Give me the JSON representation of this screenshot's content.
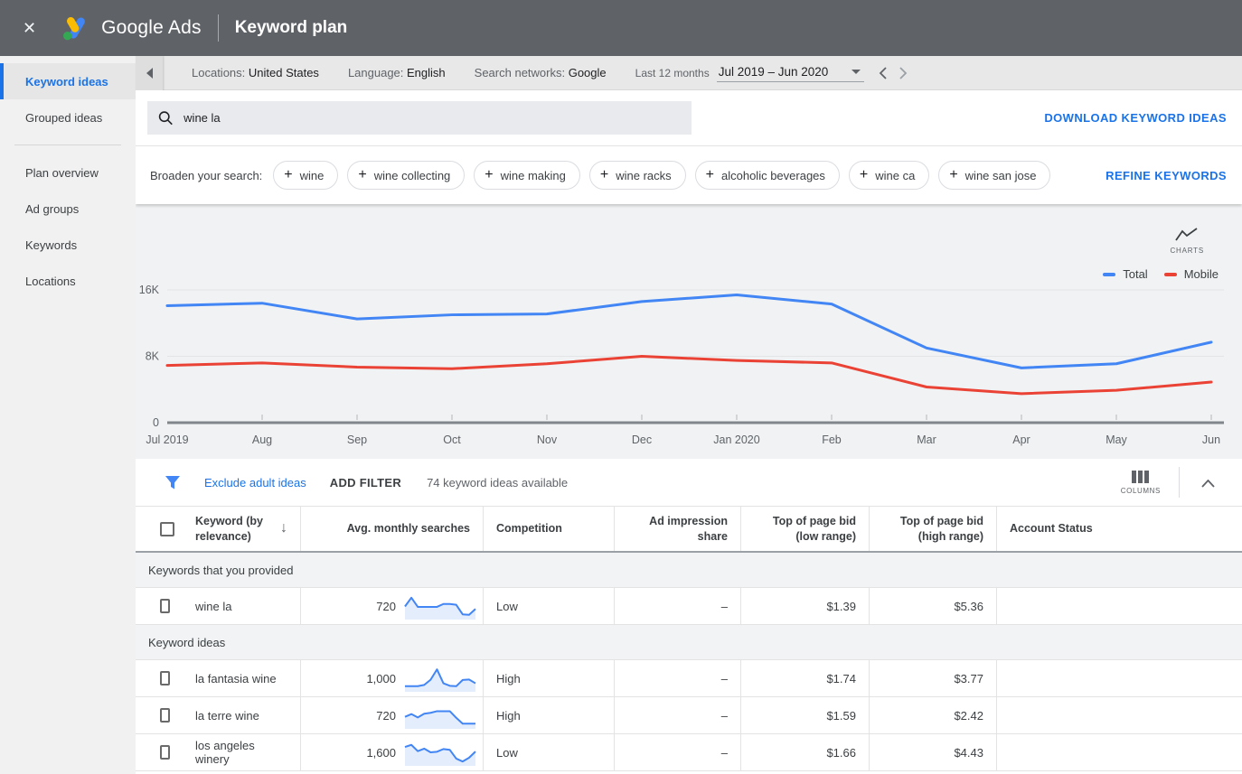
{
  "header": {
    "close_label": "✕",
    "app_name": "Google Ads",
    "page_title": "Keyword plan"
  },
  "toolbar": {
    "filters": [
      {
        "label": "Locations:",
        "value": "United States"
      },
      {
        "label": "Language:",
        "value": "English"
      },
      {
        "label": "Search networks:",
        "value": "Google"
      }
    ],
    "date_range_label": "Last 12 months",
    "date_range_value": "Jul 2019 – Jun 2020"
  },
  "sidebar": {
    "items_top": [
      {
        "label": "Keyword ideas",
        "active": true
      },
      {
        "label": "Grouped ideas",
        "active": false
      }
    ],
    "items_bottom": [
      {
        "label": "Plan overview",
        "active": false
      },
      {
        "label": "Ad groups",
        "active": false
      },
      {
        "label": "Keywords",
        "active": false
      },
      {
        "label": "Locations",
        "active": false
      }
    ]
  },
  "search": {
    "value": "wine la"
  },
  "actions": {
    "download": "DOWNLOAD KEYWORD IDEAS",
    "refine": "REFINE KEYWORDS"
  },
  "broaden": {
    "label": "Broaden your search:",
    "chips": [
      "wine",
      "wine collecting",
      "wine making",
      "wine racks",
      "alcoholic beverages",
      "wine ca",
      "wine san jose"
    ]
  },
  "chart_data": {
    "type": "line",
    "title": "Monthly search volume trend",
    "x": [
      "Jul 2019",
      "Aug",
      "Sep",
      "Oct",
      "Nov",
      "Dec",
      "Jan 2020",
      "Feb",
      "Mar",
      "Apr",
      "May",
      "Jun"
    ],
    "series": [
      {
        "name": "Total",
        "color": "#4285f4",
        "values": [
          14100,
          14400,
          12500,
          13000,
          13100,
          14600,
          15400,
          14300,
          9000,
          6600,
          7100,
          9700
        ]
      },
      {
        "name": "Mobile",
        "color": "#ea4335",
        "values": [
          6900,
          7200,
          6700,
          6500,
          7100,
          8000,
          7500,
          7200,
          4300,
          3500,
          3900,
          4900
        ]
      }
    ],
    "ylim": [
      0,
      16000
    ],
    "yticks": [
      {
        "v": 0,
        "label": "0"
      },
      {
        "v": 8000,
        "label": "8K"
      },
      {
        "v": 16000,
        "label": "16K"
      }
    ],
    "legend_position": "top-right",
    "grid": true,
    "charts_toggle_label": "CHARTS"
  },
  "filter_bar": {
    "exclude_link": "Exclude adult ideas",
    "add_filter": "ADD FILTER",
    "count_text": "74 keyword ideas available",
    "columns_label": "COLUMNS"
  },
  "table": {
    "columns": [
      "Keyword (by relevance)",
      "Avg. monthly searches",
      "Competition",
      "Ad impression share",
      "Top of page bid (low range)",
      "Top of page bid (high range)",
      "Account Status"
    ],
    "groups": [
      {
        "label": "Keywords that you provided",
        "rows": [
          {
            "keyword": "wine la",
            "avg": "720",
            "competition": "Low",
            "ad_share": "–",
            "bid_low": "$1.39",
            "bid_high": "$5.36",
            "account_status": "",
            "spark": [
              50,
              92,
              48,
              48,
              48,
              48,
              62,
              62,
              58,
              12,
              10,
              38
            ]
          }
        ]
      },
      {
        "label": "Keyword ideas",
        "rows": [
          {
            "keyword": "la fantasia wine",
            "avg": "1,000",
            "competition": "High",
            "ad_share": "–",
            "bid_low": "$1.74",
            "bid_high": "$3.77",
            "account_status": "",
            "spark": [
              14,
              14,
              14,
              20,
              45,
              95,
              28,
              16,
              14,
              44,
              46,
              28
            ]
          },
          {
            "keyword": "la terre wine",
            "avg": "720",
            "competition": "High",
            "ad_share": "–",
            "bid_low": "$1.59",
            "bid_high": "$2.42",
            "account_status": "",
            "spark": [
              45,
              58,
              42,
              60,
              64,
              72,
              72,
              72,
              40,
              12,
              12,
              12
            ]
          },
          {
            "keyword": "los angeles winery",
            "avg": "1,600",
            "competition": "Low",
            "ad_share": "–",
            "bid_low": "$1.66",
            "bid_high": "$4.43",
            "account_status": "",
            "spark": [
              78,
              88,
              58,
              70,
              52,
              55,
              68,
              64,
              22,
              8,
              26,
              56
            ]
          }
        ]
      }
    ]
  },
  "colors": {
    "link_blue": "#1a73e8",
    "chart_blue": "#4285f4",
    "chart_red": "#ea4335",
    "spark_fill": "#e4edfb"
  }
}
